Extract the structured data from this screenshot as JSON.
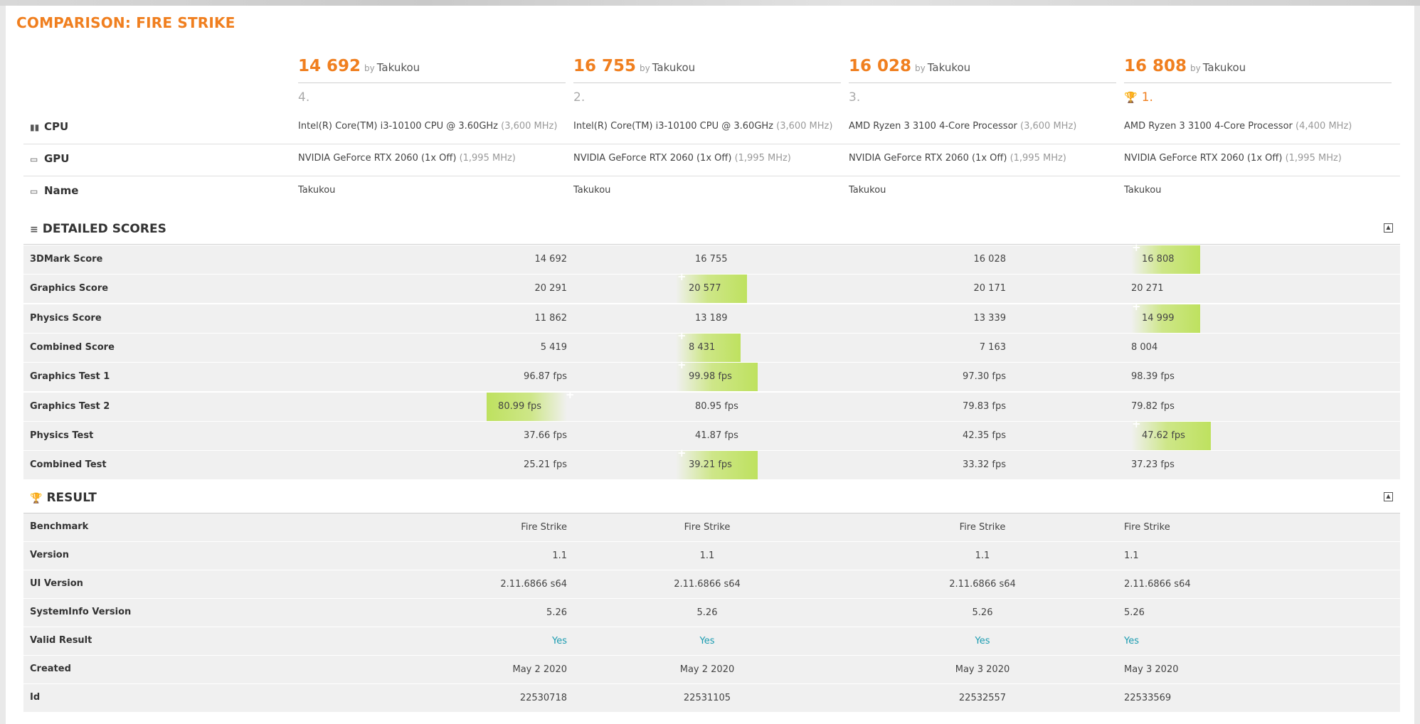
{
  "title": "COMPARISON: FIRE STRIKE",
  "results": [
    {
      "score": "14 692",
      "by": "by",
      "user": "Takukou",
      "rank": "4.",
      "cpu": "Intel(R) Core(TM) i3-10100 CPU @ 3.60GHz",
      "cpu_clock": "(3,600 MHz)",
      "gpu": "NVIDIA GeForce RTX 2060 (1x Off)",
      "gpu_clock": "(1,995 MHz)",
      "name": "Takukou"
    },
    {
      "score": "16 755",
      "by": "by",
      "user": "Takukou",
      "rank": "2.",
      "cpu": "Intel(R) Core(TM) i3-10100 CPU @ 3.60GHz",
      "cpu_clock": "(3,600 MHz)",
      "gpu": "NVIDIA GeForce RTX 2060 (1x Off)",
      "gpu_clock": "(1,995 MHz)",
      "name": "Takukou"
    },
    {
      "score": "16 028",
      "by": "by",
      "user": "Takukou",
      "rank": "3.",
      "cpu": "AMD Ryzen 3 3100 4-Core Processor",
      "cpu_clock": "(3,600 MHz)",
      "gpu": "NVIDIA GeForce RTX 2060 (1x Off)",
      "gpu_clock": "(1,995 MHz)",
      "name": "Takukou"
    },
    {
      "score": "16 808",
      "by": "by",
      "user": "Takukou",
      "rank": "1.",
      "cpu": "AMD Ryzen 3 3100 4-Core Processor",
      "cpu_clock": "(4,400 MHz)",
      "gpu": "NVIDIA GeForce RTX 2060 (1x Off)",
      "gpu_clock": "(1,995 MHz)",
      "name": "Takukou"
    }
  ],
  "labels": {
    "cpu": "CPU",
    "gpu": "GPU",
    "name": "Name"
  },
  "detailed": {
    "title": "DETAILED SCORES",
    "rows": [
      {
        "label": "3DMark Score",
        "values": [
          "14 692",
          "16 755",
          "16 028",
          "16 808"
        ],
        "best": 3
      },
      {
        "label": "Graphics Score",
        "values": [
          "20 291",
          "20 577",
          "20 171",
          "20 271"
        ],
        "best": 1
      },
      {
        "label": "Physics Score",
        "values": [
          "11 862",
          "13 189",
          "13 339",
          "14 999"
        ],
        "best": 3
      },
      {
        "label": "Combined Score",
        "values": [
          "5 419",
          "8 431",
          "7 163",
          "8 004"
        ],
        "best": 1
      },
      {
        "label": "Graphics Test 1",
        "values": [
          "96.87 fps",
          "99.98 fps",
          "97.30 fps",
          "98.39 fps"
        ],
        "best": 1
      },
      {
        "label": "Graphics Test 2",
        "values": [
          "80.99 fps",
          "80.95 fps",
          "79.83 fps",
          "79.82 fps"
        ],
        "best": 0
      },
      {
        "label": "Physics Test",
        "values": [
          "37.66 fps",
          "41.87 fps",
          "42.35 fps",
          "47.62 fps"
        ],
        "best": 3
      },
      {
        "label": "Combined Test",
        "values": [
          "25.21 fps",
          "39.21 fps",
          "33.32 fps",
          "37.23 fps"
        ],
        "best": 1
      }
    ]
  },
  "result": {
    "title": "RESULT",
    "rows": [
      {
        "label": "Benchmark",
        "values": [
          "Fire Strike",
          "Fire Strike",
          "Fire Strike",
          "Fire Strike"
        ]
      },
      {
        "label": "Version",
        "values": [
          "1.1",
          "1.1",
          "1.1",
          "1.1"
        ]
      },
      {
        "label": "UI Version",
        "values": [
          "2.11.6866 s64",
          "2.11.6866 s64",
          "2.11.6866 s64",
          "2.11.6866 s64"
        ]
      },
      {
        "label": "SystemInfo Version",
        "values": [
          "5.26",
          "5.26",
          "5.26",
          "5.26"
        ]
      },
      {
        "label": "Valid Result",
        "values": [
          "Yes",
          "Yes",
          "Yes",
          "Yes"
        ]
      },
      {
        "label": "Created",
        "values": [
          "May 2 2020",
          "May 2 2020",
          "May 3 2020",
          "May 3 2020"
        ]
      },
      {
        "label": "Id",
        "values": [
          "22530718",
          "22531105",
          "22532557",
          "22533569"
        ]
      }
    ]
  },
  "icons": {
    "cpu": "cpu-chip-icon",
    "gpu": "monitor-icon",
    "name": "laptop-icon",
    "detailed": "list-icon",
    "result": "trophy-icon",
    "collapse": "collapse-up-icon",
    "best": "plus-icon"
  },
  "colors": {
    "accent": "#f07f1f",
    "highlight": "#c5e46e",
    "valid": "#1a9bb0"
  }
}
